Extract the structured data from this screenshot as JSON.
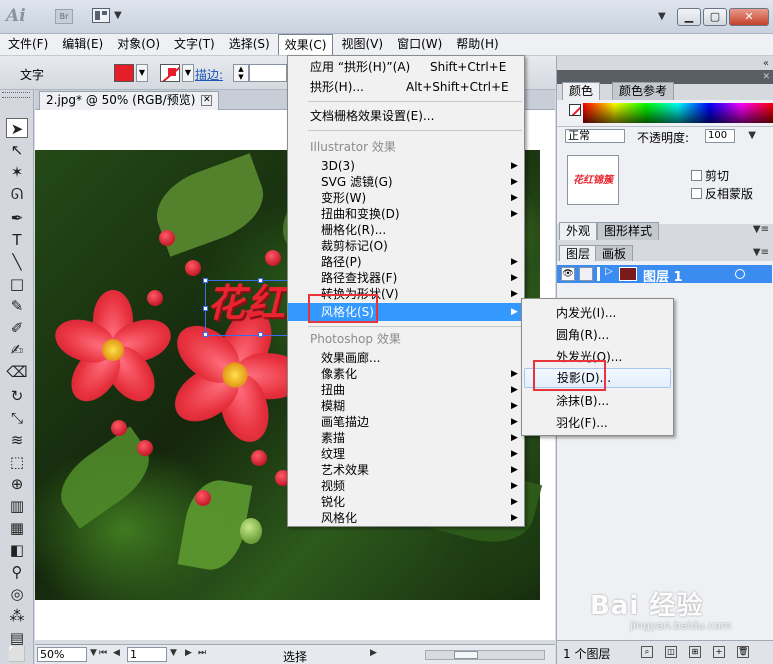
{
  "titlebar": {
    "app_logo": "Ai",
    "bridge_logo": "Br",
    "min_label": "▁",
    "max_label": "▢",
    "close_label": "✕"
  },
  "menubar": [
    {
      "label": "文件(F)"
    },
    {
      "label": "编辑(E)"
    },
    {
      "label": "对象(O)"
    },
    {
      "label": "文字(T)"
    },
    {
      "label": "选择(S)"
    },
    {
      "label": "效果(C)",
      "active": true
    },
    {
      "label": "视图(V)"
    },
    {
      "label": "窗口(W)"
    },
    {
      "label": "帮助(H)"
    }
  ],
  "controlbar": {
    "tool_name": "文字",
    "stroke_label": "描边:",
    "fill_color": "#e51e2a"
  },
  "document": {
    "tab_title": "2.jpg* @ 50% (RGB/预览)",
    "artwork_text": "花红锦簇"
  },
  "statusbar": {
    "zoom": "50%",
    "page": "1",
    "current_tool": "选择"
  },
  "effects_menu": {
    "apply_last": {
      "label": "应用 “拱形(H)”(A)",
      "shortcut": "Shift+Ctrl+E"
    },
    "last_effect": {
      "label": "拱形(H)...",
      "shortcut": "Alt+Shift+Ctrl+E"
    },
    "raster_settings": "文档栅格效果设置(E)...",
    "illustrator_header": "Illustrator 效果",
    "illustrator_items": [
      "3D(3)",
      "SVG 滤镜(G)",
      "变形(W)",
      "扭曲和变换(D)",
      "栅格化(R)...",
      "裁剪标记(O)",
      "路径(P)",
      "路径查找器(F)",
      "转换为形状(V)",
      "风格化(S)"
    ],
    "photoshop_header": "Photoshop 效果",
    "photoshop_items": [
      "效果画廊...",
      "像素化",
      "扭曲",
      "模糊",
      "画笔描边",
      "素描",
      "纹理",
      "艺术效果",
      "视频",
      "锐化",
      "风格化"
    ]
  },
  "stylize_submenu": {
    "items": [
      "内发光(I)...",
      "圆角(R)...",
      "外发光(O)...",
      "投影(D)...",
      "涂抹(B)...",
      "羽化(F)..."
    ],
    "hovered": "投影(D)..."
  },
  "panels": {
    "color_tabs": [
      "颜色",
      "颜色参考"
    ],
    "blend_mode": "正常",
    "opacity_label": "不透明度:",
    "opacity_value": "100",
    "thumb_text": "花红锦簇",
    "clip_label": "剪切",
    "invert_mask_label": "反相蒙版",
    "appearance_tabs": [
      "外观",
      "图形样式"
    ],
    "layers_tabs": [
      "图层",
      "画板"
    ],
    "layer_name": "图层 1",
    "layer_count": "1 个图层"
  },
  "watermark": {
    "main": "Bai 经验",
    "sub": "jingyan.baidu.com"
  },
  "colors": {
    "highlight": "#3399ff",
    "annotation": "#e8343c",
    "layer_selected": "#3b8cf0"
  }
}
